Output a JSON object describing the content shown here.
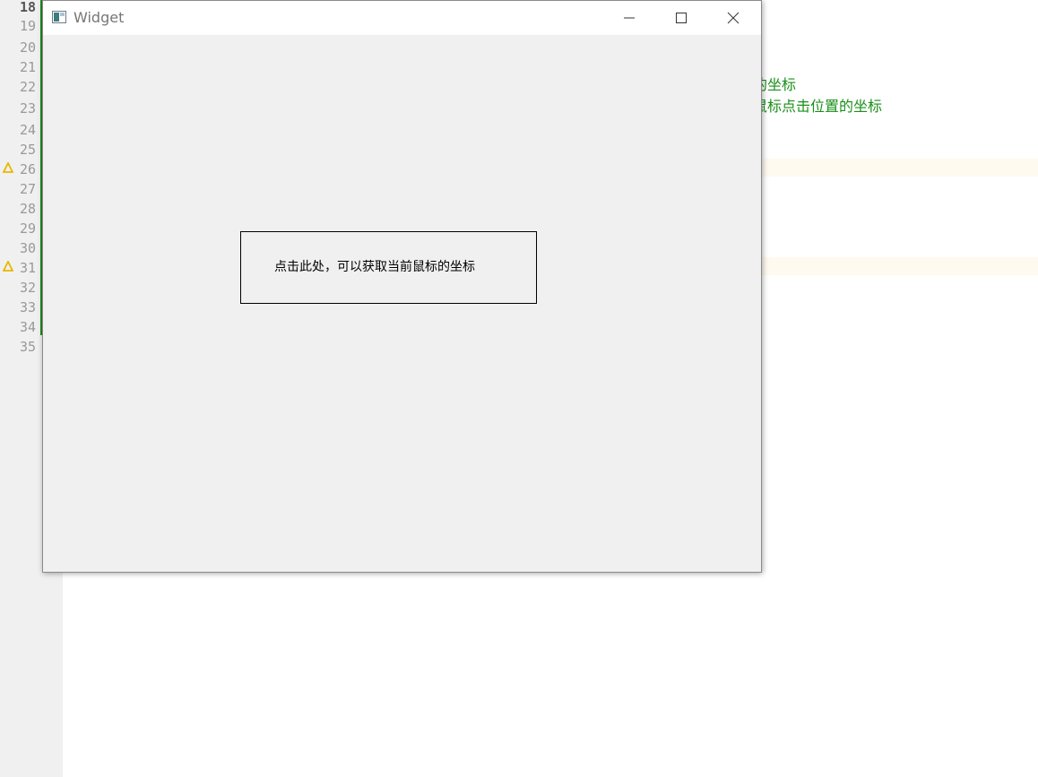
{
  "editor": {
    "line_numbers": [
      "18",
      "19",
      "20",
      "21",
      "22",
      "23",
      "24",
      "25",
      "26",
      "27",
      "28",
      "29",
      "30",
      "31",
      "32",
      "33",
      "34",
      "35"
    ],
    "warning_lines": [
      "26",
      "31"
    ],
    "comment_fragment_1": "的坐标",
    "comment_fragment_2": "鼠标点击位置的坐标",
    "colors": {
      "gutter_bg": "#f0f0f0",
      "change_bar": "#1d8a1d",
      "comment": "#1a8f1a",
      "warning": "#e6b800"
    }
  },
  "window": {
    "title": "Widget",
    "app_icon": "app-window-icon",
    "controls": {
      "minimize_icon": "minimize-icon",
      "maximize_icon": "maximize-icon",
      "close_icon": "close-icon"
    },
    "click_box": {
      "label": "点击此处，可以获取当前鼠标的坐标"
    },
    "colors": {
      "client_bg": "#f0f0f0",
      "titlebar_bg": "#ffffff"
    }
  }
}
